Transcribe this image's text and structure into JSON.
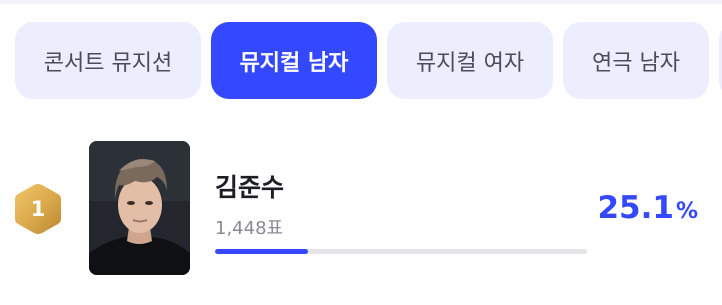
{
  "tabs": [
    {
      "label": "콘서트 뮤지션",
      "active": false
    },
    {
      "label": "뮤지컬 남자",
      "active": true
    },
    {
      "label": "뮤지컬 여자",
      "active": false
    },
    {
      "label": "연극 남자",
      "active": false
    },
    {
      "label": "",
      "active": false
    }
  ],
  "ranking": {
    "rank": "1",
    "name": "김준수",
    "votes": "1,448표",
    "percent_value": "25.1",
    "percent_sign": "%",
    "vote_share_fraction": 0.251
  },
  "colors": {
    "accent": "#3448ff",
    "tab_bg": "#ecedfd",
    "badge_gold": "#d9a84a"
  },
  "icons": {
    "badge": "gold-hexagon-badge"
  }
}
